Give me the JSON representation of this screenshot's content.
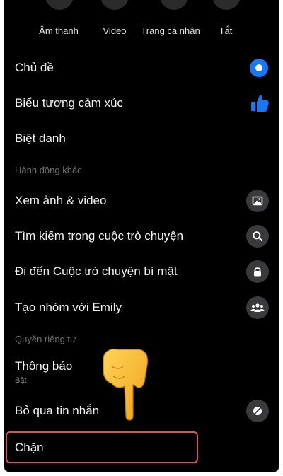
{
  "top_actions": [
    {
      "label": "Âm thanh"
    },
    {
      "label": "Video"
    },
    {
      "label": "Trang cá nhân"
    },
    {
      "label": "Tắt"
    }
  ],
  "menu": {
    "theme": {
      "label": "Chủ đề",
      "icon": "theme-circle-icon",
      "color": "#1877f2"
    },
    "emoji": {
      "label": "Biểu tượng cảm xúc",
      "icon": "thumbs-up-icon",
      "color": "#1877f2"
    },
    "nicknames": {
      "label": "Biệt danh"
    },
    "more_actions_header": "Hành động khác",
    "media": {
      "label": "Xem ảnh & video",
      "icon": "image-icon"
    },
    "search": {
      "label": "Tìm kiếm trong cuộc trò chuyện",
      "icon": "search-icon"
    },
    "secret": {
      "label": "Đi đến Cuộc trò chuyện bí mật",
      "icon": "lock-icon"
    },
    "group": {
      "label": "Tạo nhóm với Emily",
      "icon": "group-icon"
    },
    "privacy_header": "Quyền riêng tư",
    "notifications": {
      "label": "Thông báo",
      "sub": "Bật"
    },
    "ignore": {
      "label": "Bỏ qua tin nhắn",
      "icon": "ignore-icon"
    },
    "block": {
      "label": "Chặn"
    }
  },
  "colors": {
    "background": "#000000",
    "accent": "#1877f2",
    "highlight": "#d9534f"
  }
}
